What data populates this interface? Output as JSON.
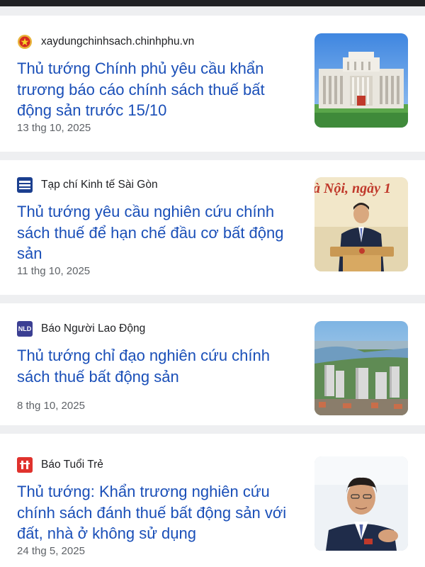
{
  "articles": [
    {
      "source": "xaydungchinhsach.chinhphu.vn",
      "source_icon": "vietnam-emblem-icon",
      "headline": "Thủ tướng Chính phủ yêu cầu khẩn trương báo cáo chính sách thuế bất động sản trước 15/10",
      "date": "13 thg 10, 2025",
      "thumbnail": "government-building-image"
    },
    {
      "source": "Tạp chí Kinh tế Sài Gòn",
      "source_icon": "ktsg-logo-icon",
      "headline": "Thủ tướng yêu cầu nghiên cứu chính sách thuế để hạn chế đầu cơ bất động sản",
      "date": "11 thg 10, 2025",
      "thumbnail": "prime-minister-podium-image",
      "thumbnail_banner_text": "à Nội, ngày 1"
    },
    {
      "source": "Báo Người Lao Động",
      "source_icon": "nld-logo-icon",
      "source_icon_text": "NLD",
      "headline": "Thủ tướng chỉ đạo nghiên cứu chính sách thuế bất động sản",
      "date": "8 thg 10, 2025",
      "thumbnail": "city-skyline-image"
    },
    {
      "source": "Báo Tuổi Trẻ",
      "source_icon": "tuoi-tre-logo-icon",
      "headline": "Thủ tướng: Khẩn trương nghiên cứu chính sách đánh thuế bất động sản với đất, nhà ở không sử dụng",
      "date": "24 thg 5, 2025",
      "thumbnail": "prime-minister-portrait-image"
    }
  ],
  "colors": {
    "headline": "#1a4fb8",
    "date": "#5f6368",
    "separator": "#eeeff1"
  }
}
